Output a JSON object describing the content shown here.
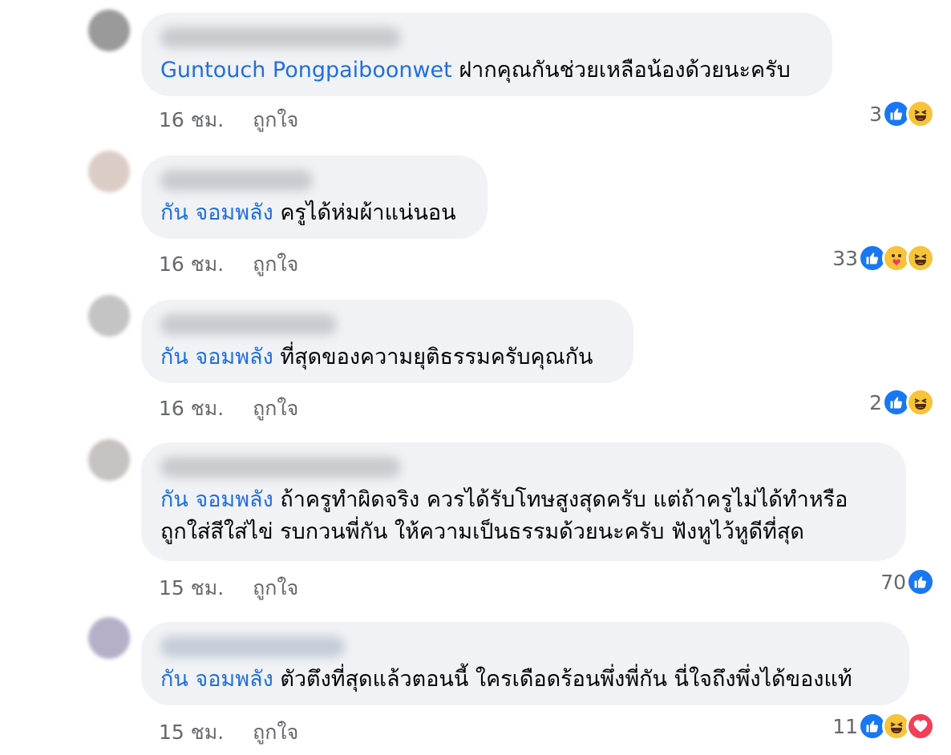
{
  "comments": [
    {
      "mention": "Guntouch Pongpaiboonwet",
      "lines": [
        "ฝากคุณกันช่วยเหลือน้องด้วยนะครับ"
      ],
      "time": "16 ชม.",
      "like_label": "ถูกใจ",
      "reaction_count": "3",
      "reactions": [
        "like-icon",
        "haha-icon"
      ]
    },
    {
      "mention": "กัน จอมพลัง",
      "lines": [
        "ครูได้ห่มผ้าแน่นอน"
      ],
      "time": "16 ชม.",
      "like_label": "ถูกใจ",
      "reaction_count": "33",
      "reactions": [
        "like-icon",
        "care-icon",
        "haha-icon"
      ]
    },
    {
      "mention": "กัน จอมพลัง",
      "lines": [
        "ที่สุดของความยุติธรรมครับคุณกัน"
      ],
      "time": "16 ชม.",
      "like_label": "ถูกใจ",
      "reaction_count": "2",
      "reactions": [
        "like-icon",
        "haha-icon"
      ]
    },
    {
      "mention": "กัน จอมพลัง",
      "lines": [
        "ถ้าครูทำผิดจริง ควรได้รับโทษสูงสุดครับ แต่ถ้าครูไม่ได้ทำหรือ",
        "ถูกใส่สีใส่ไข่ รบกวนพี่กัน ให้ความเป็นธรรมด้วยนะครับ ฟังหูไว้หูดีที่สุด"
      ],
      "time": "15 ชม.",
      "like_label": "ถูกใจ",
      "reaction_count": "70",
      "reactions": [
        "like-icon"
      ]
    },
    {
      "mention": "กัน จอมพลัง",
      "lines": [
        "ตัวตึงที่สุดแล้วตอนนี้ ใครเดือดร้อนพึ่งพี่กัน นี่ใจถึงพึ่งได้ของแท้"
      ],
      "time": "15 ชม.",
      "like_label": "ถูกใจ",
      "reaction_count": "11",
      "reactions": [
        "like-icon",
        "haha-icon",
        "love-icon"
      ]
    }
  ],
  "colors": {
    "mention": "#216fdb",
    "bubble": "#f0f2f5",
    "meta": "#65676b",
    "like": "#1877f2",
    "haha": "#f7c33b",
    "love": "#f33e58"
  }
}
